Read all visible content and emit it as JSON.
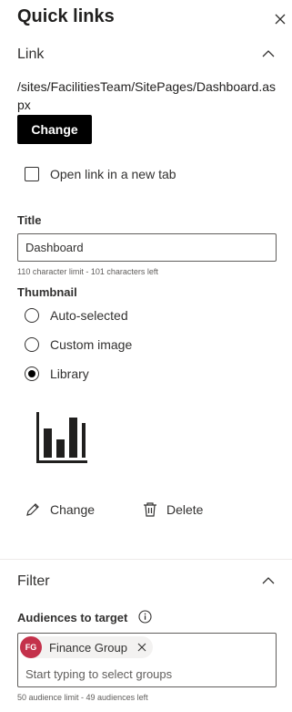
{
  "panel": {
    "title": "Quick links"
  },
  "link_section": {
    "heading": "Link",
    "url": "/sites/FacilitiesTeam/SitePages/Dashboard.aspx",
    "change_button": "Change",
    "new_tab_label": "Open link in a new tab",
    "new_tab_checked": false
  },
  "title_field": {
    "label": "Title",
    "value": "Dashboard",
    "hint": "110 character limit - 101 characters left"
  },
  "thumbnail": {
    "label": "Thumbnail",
    "options": [
      "Auto-selected",
      "Custom image",
      "Library"
    ],
    "selected": "Library",
    "icon": "bar-chart-icon",
    "change_label": "Change",
    "delete_label": "Delete"
  },
  "filter_section": {
    "heading": "Filter",
    "audiences_label": "Audiences to target",
    "selected_group": {
      "initials": "FG",
      "name": "Finance Group",
      "color": "#c4314b"
    },
    "placeholder": "Start typing to select groups",
    "hint": "50 audience limit - 49 audiences left"
  }
}
